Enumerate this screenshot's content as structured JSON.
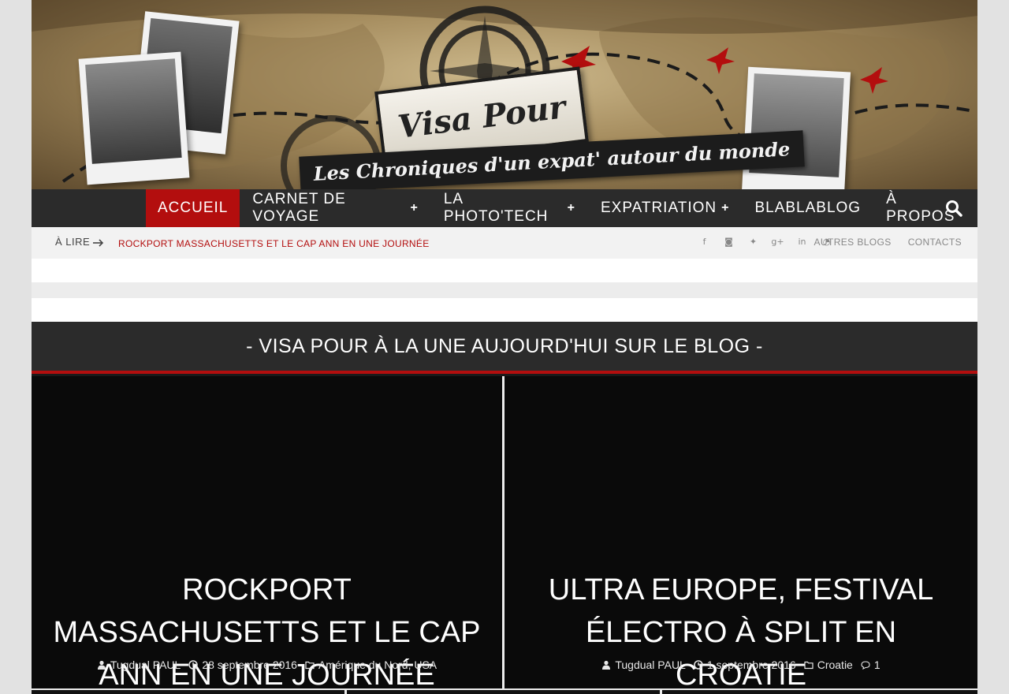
{
  "banner": {
    "logo_text": "Visa Pour",
    "tagline": "Les Chroniques d'un expat' autour du monde"
  },
  "nav": {
    "items": [
      {
        "label": "ACCUEIL",
        "has_submenu": false,
        "active": true
      },
      {
        "label": "CARNET DE VOYAGE",
        "has_submenu": true,
        "active": false
      },
      {
        "label": "LA PHOTO'TECH",
        "has_submenu": true,
        "active": false
      },
      {
        "label": "EXPATRIATION",
        "has_submenu": true,
        "active": false
      },
      {
        "label": "BLABLABLOG",
        "has_submenu": false,
        "active": false
      },
      {
        "label": "À PROPOS",
        "has_submenu": false,
        "active": false
      }
    ],
    "search_icon": "search-icon",
    "accent_color": "#b30e0e"
  },
  "topbar": {
    "label": "À LIRE",
    "headline": "ROCKPORT MASSACHUSETTS ET LE CAP ANN EN UNE JOURNÉE",
    "social_icons": [
      "facebook-icon",
      "instagram-icon",
      "twitter-icon",
      "google-plus-icon",
      "linkedin-icon",
      "rss-icon"
    ],
    "links": [
      "AUTRES BLOGS",
      "CONTACTS"
    ]
  },
  "section": {
    "title": "- VISA POUR À LA UNE AUJOURD'HUI SUR LE BLOG -"
  },
  "featured": [
    {
      "title": "ROCKPORT MASSACHUSETTS ET LE CAP ANN EN UNE JOURNÉE",
      "author": "Tugdual PAUL",
      "date": "28 septembre 2016",
      "categories": "Amérique du Nord, USA",
      "comments": ""
    },
    {
      "title": "ULTRA EUROPE, FESTIVAL ÉLECTRO À SPLIT EN CROATIE",
      "author": "Tugdual PAUL",
      "date": "1 septembre 2016",
      "categories": "Croatie",
      "comments": "1"
    }
  ]
}
